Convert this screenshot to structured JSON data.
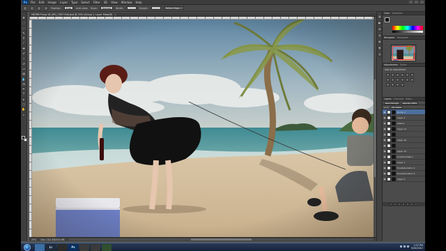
{
  "app": {
    "logo": "Ps",
    "menu": [
      "File",
      "Edit",
      "Image",
      "Layer",
      "Type",
      "Select",
      "Filter",
      "3D",
      "View",
      "Window",
      "Help"
    ]
  },
  "options_bar": {
    "feather_label": "Feather:",
    "feather_value": "0 px",
    "antialias_label": "Anti-alias",
    "style_label": "Style:",
    "style_value": "Normal",
    "width_label": "Width:",
    "height_label": "Height:",
    "refine_edge": "Refine Edge..."
  },
  "document": {
    "tab_title": "HB7RB Pinup VE_IMG_7907 Edit.psd @ 25% (Group 1, Layer Mask/8)",
    "close_glyph": "×",
    "status_zoom": "25%",
    "status_doc": "Doc: 102.3M/555.9M"
  },
  "panels": {
    "color_tabs": [
      "Color",
      "Swatches"
    ],
    "navigator_tabs": [
      "Navigator",
      "Histogram"
    ],
    "adjustments_tabs": [
      "Adjustments",
      "Styles"
    ],
    "adjustments_title": "Add an adjustment",
    "layers_tabs": [
      "Layers",
      "Channels",
      "Paths"
    ],
    "blend_mode": "Pass Through",
    "opacity_label": "Opacity: 100%",
    "lock_label": "Lock:",
    "fill_label": "Fill: 100%",
    "layers": [
      {
        "name": "Group 1",
        "active": true
      },
      {
        "name": "Layer 1",
        "active": false
      },
      {
        "name": "lettuce",
        "active": false
      },
      {
        "name": "Layer 11",
        "active": false
      },
      {
        "name": "",
        "active": false
      },
      {
        "name": "Layer 10",
        "active": false
      },
      {
        "name": "",
        "active": false
      },
      {
        "name": "Layer 12",
        "active": false
      },
      {
        "name": "Gradient Map 1",
        "active": false
      },
      {
        "name": "Layer 1",
        "active": false
      },
      {
        "name": "Hue/Saturation 1",
        "active": false
      },
      {
        "name": "Hue/Saturation 2",
        "active": false
      },
      {
        "name": "Layer 0",
        "active": false
      }
    ]
  },
  "taskbar": {
    "buttons": [
      {
        "label": "",
        "color": "#3a6ea5",
        "name": "folder-task-button"
      },
      {
        "label": "Lr",
        "color": "#1e2b3a",
        "name": "lightroom-task-button"
      },
      {
        "label": "",
        "color": "#2b2b2b",
        "name": "app-task-button"
      },
      {
        "label": "Ps",
        "color": "#0a2f5c",
        "name": "photoshop-task-button"
      },
      {
        "label": "",
        "color": "#3a3a3a",
        "name": "app2-task-button"
      },
      {
        "label": "",
        "color": "#3a3a3a",
        "name": "app3-task-button"
      },
      {
        "label": "",
        "color": "#2f4f2f",
        "name": "app4-task-button"
      }
    ],
    "time": "2:57 PM",
    "date": "9/28/2012"
  },
  "colors": {
    "accent": "#4d6f9d",
    "panel_bg": "#535353",
    "sky": "#6f93ad",
    "sand": "#d9c4a6"
  }
}
